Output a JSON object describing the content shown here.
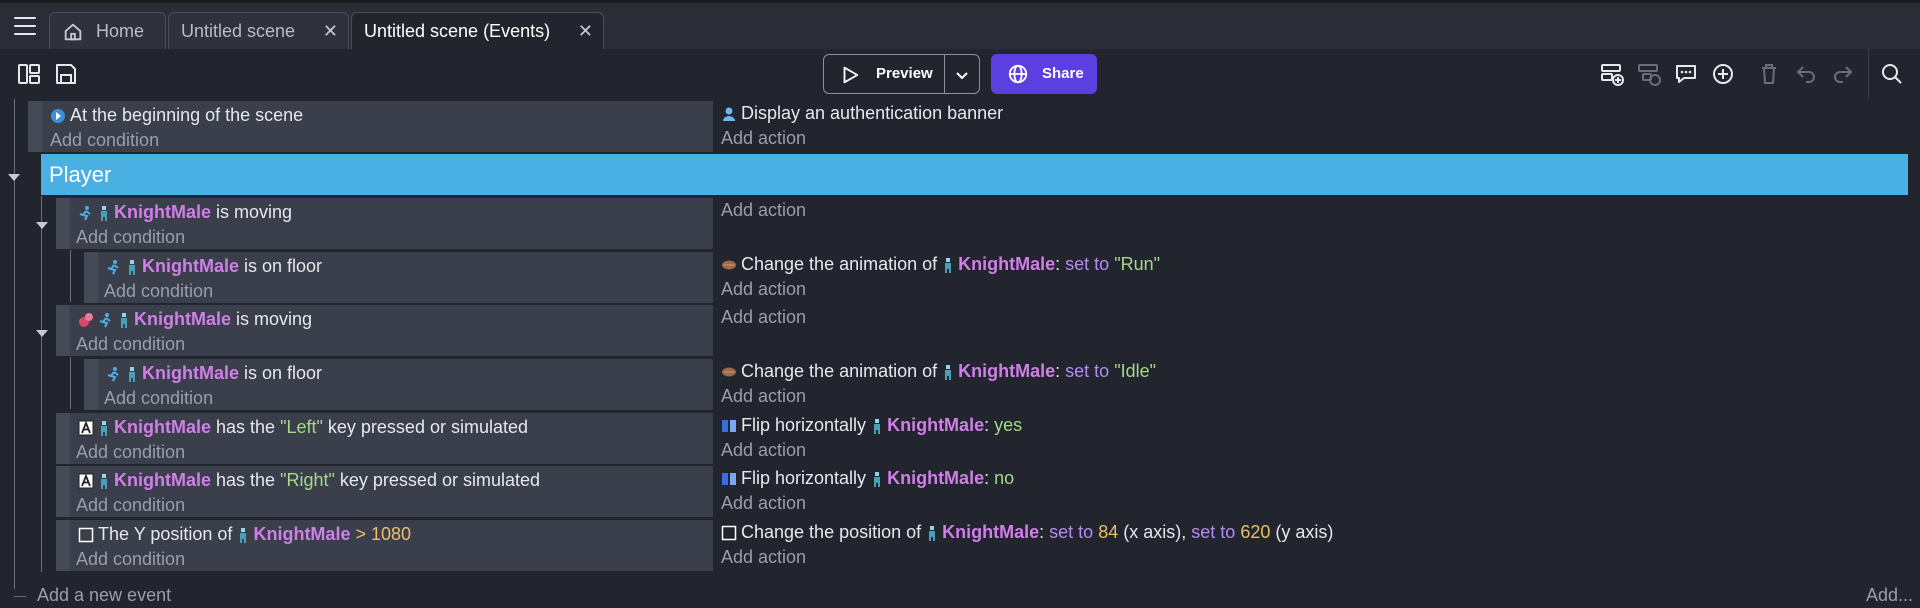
{
  "tabs": [
    {
      "label": "Home"
    },
    {
      "label": "Untitled scene"
    },
    {
      "label": "Untitled scene (Events)"
    }
  ],
  "toolbar": {
    "preview_label": "Preview",
    "share_label": "Share"
  },
  "events": {
    "first": {
      "condition": "At the beginning of the scene",
      "action": "Display an authentication banner"
    },
    "group_name": "Player",
    "add_condition": "Add condition",
    "add_action": "Add action",
    "object": "KnightMale",
    "is_moving": "is moving",
    "is_on_floor": "is on floor",
    "change_anim": "Change the animation of",
    "set_to": "set to",
    "run_val": "\"Run\"",
    "idle_val": "\"Idle\"",
    "has_the": "has the",
    "left_key": "\"Left\"",
    "right_key": "\"Right\"",
    "key_pressed": "key pressed or simulated",
    "flip": "Flip horizontally",
    "yes": "yes",
    "no": "no",
    "y_position_of": "The Y position of",
    "gt": ">",
    "y_value": "1080",
    "change_pos": "Change the position of",
    "x_val": "84",
    "x_axis": "(x axis),",
    "y_val": "620",
    "y_axis": "(y axis)",
    "add_new_event": "Add a new event",
    "add_more": "Add..."
  }
}
